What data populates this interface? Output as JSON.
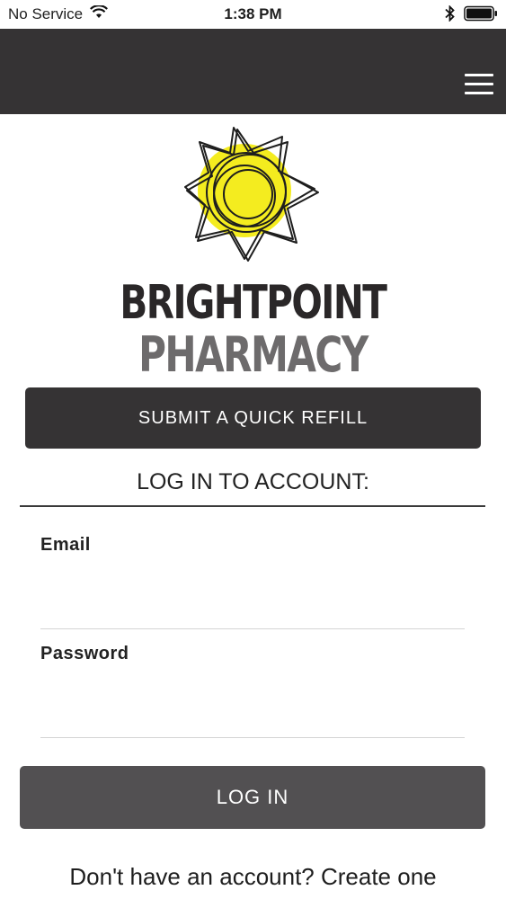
{
  "status_bar": {
    "carrier": "No Service",
    "time": "1:38 PM",
    "icons": [
      "wifi-icon",
      "bluetooth-icon",
      "battery-icon"
    ]
  },
  "header": {
    "menu_icon": "hamburger-menu-icon",
    "background_color": "#353334"
  },
  "logo": {
    "line1": "BRIGHTPOINT",
    "line2": "PHARMACY",
    "sun_color": "#f4ec1f"
  },
  "refill": {
    "label": "SUBMIT A QUICK REFILL"
  },
  "login_form": {
    "title": "LOG IN TO ACCOUNT:",
    "email_label": "Email",
    "email_value": "",
    "password_label": "Password",
    "password_value": "",
    "submit_label": "LOG IN"
  },
  "signup": {
    "text": "Don't have an account? Create one"
  }
}
